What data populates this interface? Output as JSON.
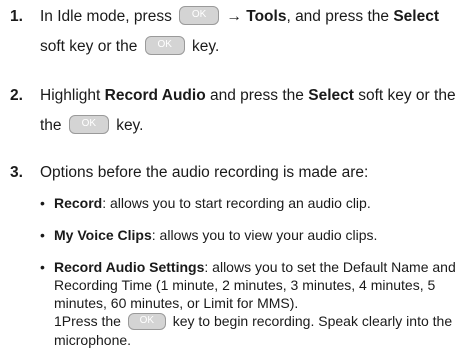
{
  "steps": [
    {
      "number": "1.",
      "parts": {
        "a": "In Idle mode, press",
        "b": "→",
        "c": "Tools",
        "d": ", and press the",
        "e": "Select",
        "f": "soft key or the",
        "g": "key."
      }
    },
    {
      "number": "2.",
      "parts": {
        "a": "Highlight",
        "b": "Record Audio",
        "c": "and press the",
        "d": "Select",
        "e": "soft key or the",
        "f": "key."
      }
    },
    {
      "number": "3.",
      "text": "Options before the audio recording is made are:"
    }
  ],
  "options": [
    {
      "bullet": "•",
      "term": "Record",
      "desc": ": allows you to start recording an audio clip."
    },
    {
      "bullet": "•",
      "term": "My Voice Clips",
      "desc": ": allows you to view your audio clips."
    },
    {
      "bullet": "•",
      "term": "Record Audio Settings",
      "desc": ": allows you to set the Default Name and Recording Time (1 minute, 2 minutes, 3 minutes, 4 minutes, 5 minutes, 60 minutes, or Limit for MMS).",
      "extra_before": "1Press the",
      "extra_after": "key to begin recording. Speak clearly into the microphone."
    }
  ],
  "key_label": "OK"
}
